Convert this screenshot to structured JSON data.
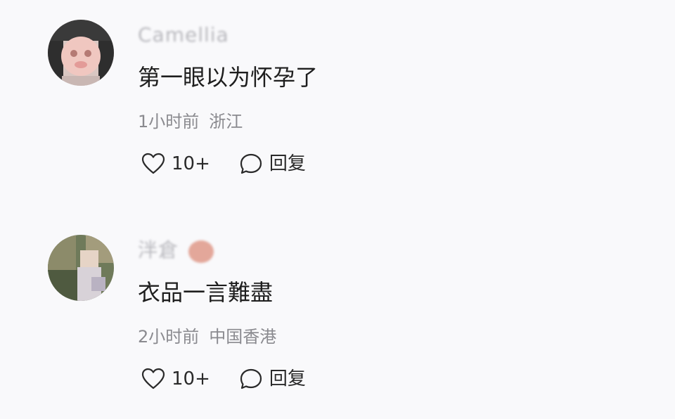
{
  "comments": [
    {
      "username": "Camellia",
      "text": "第一眼以为怀孕了",
      "time": "1小时前",
      "location": "浙江",
      "like_count": "10+",
      "reply_label": "回复"
    },
    {
      "username": "泮倉",
      "text": "衣品一言難盡",
      "time": "2小时前",
      "location": "中国香港",
      "like_count": "10+",
      "reply_label": "回复"
    }
  ],
  "icons": {
    "like": "heart-outline-icon",
    "reply": "speech-bubble-icon"
  },
  "colors": {
    "background": "#f9f9fb",
    "text_primary": "#1e1e1e",
    "text_secondary": "#8a8a8f",
    "username": "#b8b8bd",
    "badge": "#e3a79a"
  }
}
